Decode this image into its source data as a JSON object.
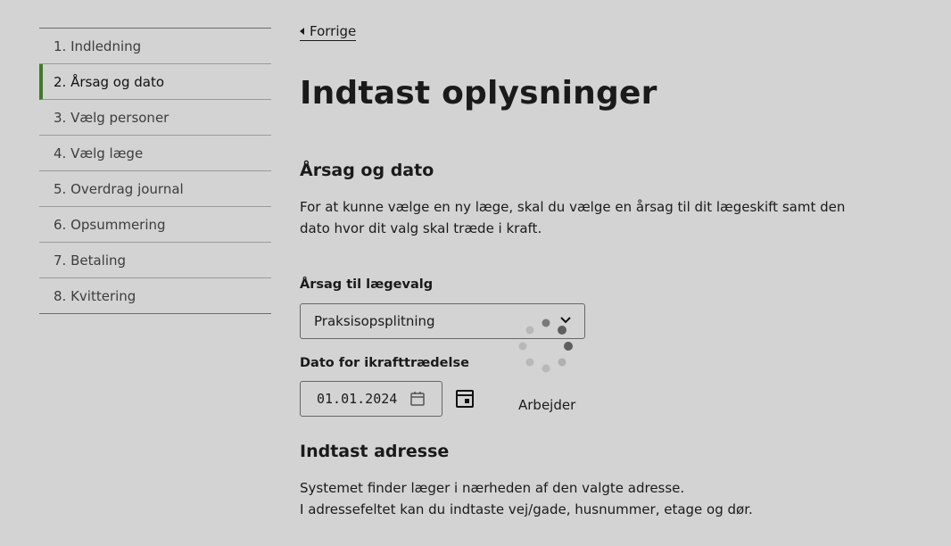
{
  "steps": [
    {
      "label": "1. Indledning",
      "active": false
    },
    {
      "label": "2. Årsag og dato",
      "active": true
    },
    {
      "label": "3. Vælg personer",
      "active": false
    },
    {
      "label": "4. Vælg læge",
      "active": false
    },
    {
      "label": "5. Overdrag journal",
      "active": false
    },
    {
      "label": "6. Opsummering",
      "active": false
    },
    {
      "label": "7. Betaling",
      "active": false
    },
    {
      "label": "8. Kvittering",
      "active": false
    }
  ],
  "nav": {
    "back_label": "Forrige"
  },
  "page": {
    "title": "Indtast oplysninger"
  },
  "reason_section": {
    "heading": "Årsag og dato",
    "description": "For at kunne vælge en ny læge, skal du vælge en årsag til dit lægeskift samt den dato hvor dit valg skal træde i kraft.",
    "reason_label": "Årsag til lægevalg",
    "reason_value": "Praksisopsplitning",
    "date_label": "Dato for ikrafttrædelse",
    "date_value": "01.01.2024"
  },
  "loading": {
    "text": "Arbejder"
  },
  "address_section": {
    "heading": "Indtast adresse",
    "line1": "Systemet finder læger i nærheden af den valgte adresse.",
    "line2": "I adressefeltet kan du indtaste vej/gade, husnummer, etage og dør."
  },
  "colors": {
    "background": "#d3d3d3",
    "accent": "#3f7a2c",
    "text": "#1a1a1a"
  },
  "icons": {
    "back": "caret-left-icon",
    "select": "chevron-down-icon",
    "date": "calendar-icon",
    "picker": "calendar-picker-icon",
    "loading": "spinner-icon"
  }
}
